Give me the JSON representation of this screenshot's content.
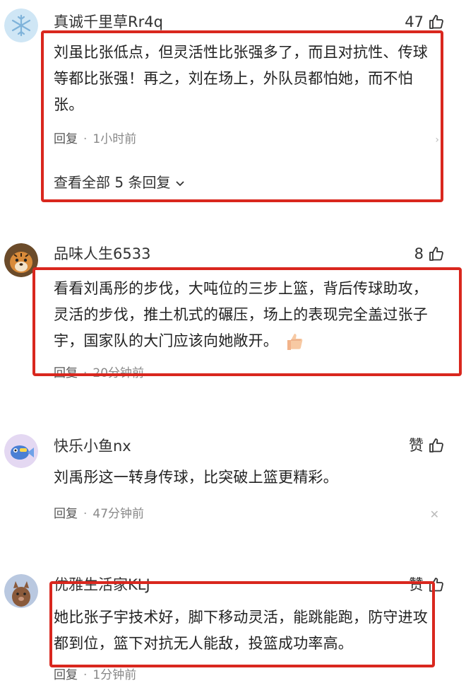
{
  "comments": [
    {
      "username": "真诚千里草Rr4q",
      "likes": "47",
      "content": "刘虽比张低点，但灵活性比张强多了，而且对抗性、传球等都比张强！再之，刘在场上，外队员都怕她，而不怕张。",
      "reply_label": "回复",
      "time": "1小时前",
      "view_replies": "查看全部 5 条回复"
    },
    {
      "username": "品味人生6533",
      "likes": "8",
      "content": "看看刘禹彤的步伐，大吨位的三步上篮，背后传球助攻，灵活的步伐，推土机式的碾压，场上的表现完全盖过张子宇，国家队的大门应该向她敞开。",
      "reply_label": "回复",
      "time": "20分钟前"
    },
    {
      "username": "快乐小鱼nx",
      "likes": "赞",
      "content": "刘禹彤这一转身传球，比突破上篮更精彩。",
      "reply_label": "回复",
      "time": "47分钟前"
    },
    {
      "username": "优雅生活家KLJ",
      "likes": "赞",
      "content": "她比张子宇技术好，脚下移动灵活，能跳能跑，防守进攻都到位，篮下对抗无人能敌，投篮成功率高。",
      "reply_label": "回复",
      "time": "1分钟前"
    }
  ],
  "icons": {
    "like": "thumbs-up-icon",
    "close": "close-icon",
    "chevron": "chevron-down-icon",
    "emoji": "thumbs-up-emoji-icon"
  },
  "colors": {
    "highlight_box": "#d9271e",
    "text": "#222222",
    "meta": "#888888"
  }
}
